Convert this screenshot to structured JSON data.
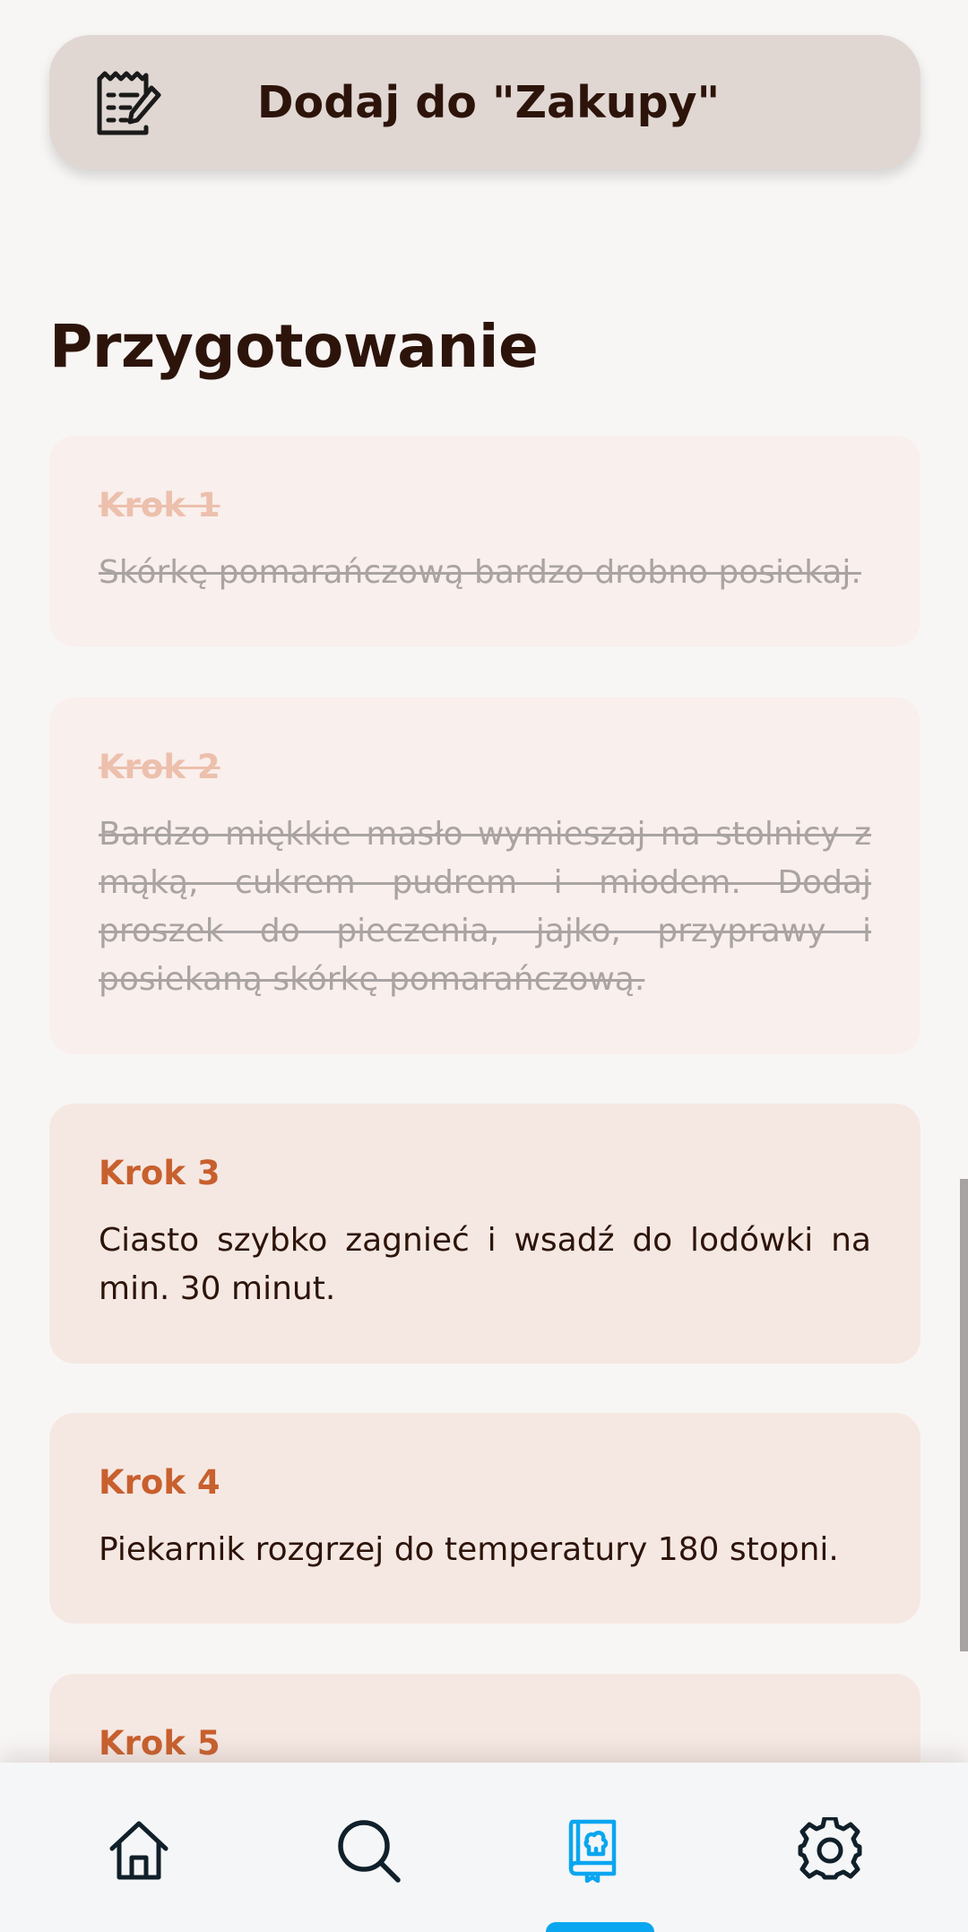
{
  "add_to_list": {
    "label": "Dodaj do \"Zakupy\"",
    "icon": "notepad-edit-icon"
  },
  "section": {
    "title": "Przygotowanie"
  },
  "steps": [
    {
      "title": "Krok 1",
      "text": "Skórkę pomarańczową bardzo drobno posiekaj.",
      "completed": true
    },
    {
      "title": "Krok 2",
      "text": "Bardzo miękkie masło wymieszaj na stolnicy z mąką, cukrem pudrem i miodem. Dodaj proszek do pieczenia, jajko, przyprawy i posiekaną skórkę pomarańczową.",
      "completed": true
    },
    {
      "title": "Krok 3",
      "text": "Ciasto szybko zagnieć i wsadź do lodówki na min. 30 minut.",
      "completed": false
    },
    {
      "title": "Krok 4",
      "text": "Piekarnik rozgrzej do temperatury 180 stopni.",
      "completed": false
    },
    {
      "title": "Krok 5",
      "text": "",
      "completed": false
    }
  ],
  "bottom_nav": {
    "items": [
      {
        "icon": "home-icon",
        "active": false
      },
      {
        "icon": "search-icon",
        "active": false
      },
      {
        "icon": "recipe-book-icon",
        "active": true
      },
      {
        "icon": "gear-icon",
        "active": false
      }
    ]
  },
  "colors": {
    "accent": "#c8602e",
    "nav_active": "#0aa6f0",
    "text_dark": "#2d140a"
  }
}
